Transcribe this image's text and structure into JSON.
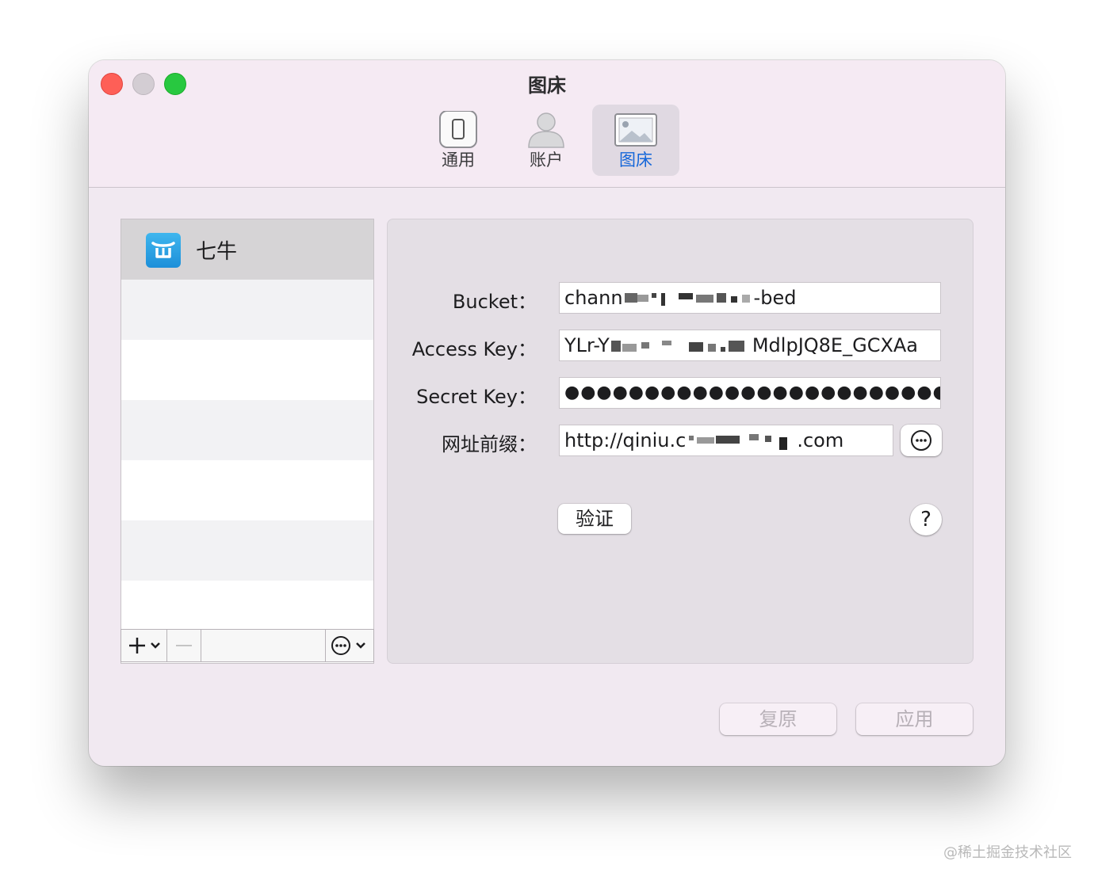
{
  "window": {
    "title": "图床"
  },
  "toolbar": {
    "items": [
      {
        "label": "通用",
        "icon": "phone-icon"
      },
      {
        "label": "账户",
        "icon": "user-icon"
      },
      {
        "label": "图床",
        "icon": "image-icon"
      }
    ],
    "active_index": 2
  },
  "services": {
    "items": [
      {
        "label": "七牛",
        "icon": "qiniu-logo"
      }
    ]
  },
  "form": {
    "bucket_label": "Bucket：",
    "bucket_value_start": "chann",
    "bucket_value_end": "-bed",
    "access_key_label": "Access Key：",
    "access_key_value_start": "YLr-Y",
    "access_key_value_end": "MdlpJQ8E_GCXAa",
    "secret_key_label": "Secret Key：",
    "secret_key_value": "●●●●●●●●●●●●●●●●●●●●●●●●●●●●●",
    "url_prefix_label": "网址前缀：",
    "url_prefix_value_start": "http://qiniu.c",
    "url_prefix_value_end": ".com",
    "verify_button": "验证",
    "help_button": "?"
  },
  "footer": {
    "restore_button": "复原",
    "apply_button": "应用"
  },
  "watermark": "@稀土掘金技术社区",
  "colors": {
    "accent": "#1466d9",
    "close": "#fe5f57",
    "minimize": "#d3cdd3",
    "zoom": "#28c840"
  }
}
